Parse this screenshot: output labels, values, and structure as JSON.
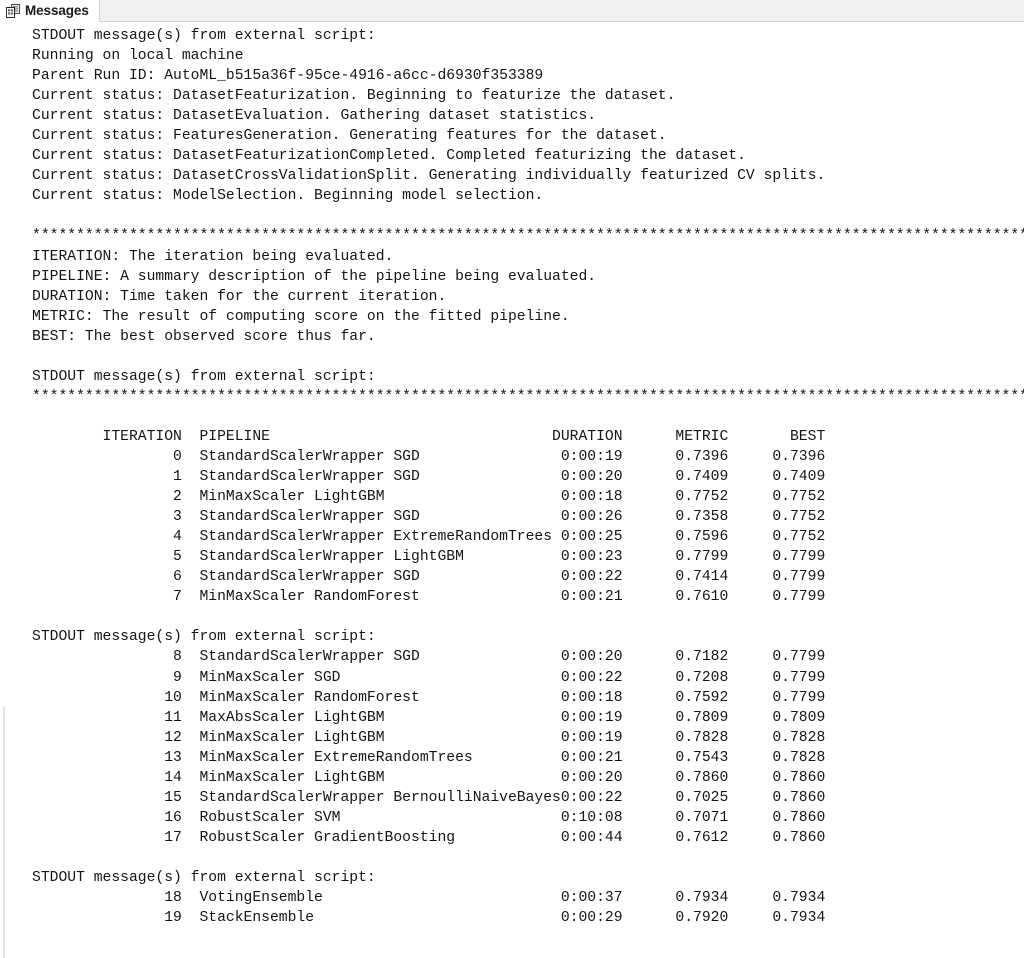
{
  "window": {
    "tab": {
      "label": "Messages",
      "icon": "messages-grid-icon"
    },
    "colors": {
      "background": "#ffffff",
      "tabstrip_background": "#f1f1f1",
      "tabstrip_border": "#d4d4d4",
      "text": "#151515",
      "rule": "#e0e0e0"
    }
  },
  "console": {
    "separator_char": "*",
    "separator_count": 119,
    "blocks": [
      {
        "type": "lines",
        "name": "run-header",
        "lines": [
          "STDOUT message(s) from external script:",
          "Running on local machine",
          "Parent Run ID: AutoML_b515a36f-95ce-4916-a6cc-d6930f353389",
          "Current status: DatasetFeaturization. Beginning to featurize the dataset.",
          "Current status: DatasetEvaluation. Gathering dataset statistics.",
          "Current status: FeaturesGeneration. Generating features for the dataset.",
          "Current status: DatasetFeaturizationCompleted. Completed featurizing the dataset.",
          "Current status: DatasetCrossValidationSplit. Generating individually featurized CV splits.",
          "Current status: ModelSelection. Beginning model selection."
        ]
      },
      {
        "type": "blank",
        "name": "blank-1"
      },
      {
        "type": "separator",
        "name": "separator-top"
      },
      {
        "type": "lines",
        "name": "legend",
        "lines": [
          "ITERATION: The iteration being evaluated.",
          "PIPELINE: A summary description of the pipeline being evaluated.",
          "DURATION: Time taken for the current iteration.",
          "METRIC: The result of computing score on the fitted pipeline.",
          "BEST: The best observed score thus far."
        ]
      },
      {
        "type": "blank",
        "name": "blank-2"
      },
      {
        "type": "lines",
        "name": "stdout-notice-2",
        "lines": [
          "STDOUT message(s) from external script:"
        ]
      },
      {
        "type": "separator",
        "name": "separator-bottom"
      },
      {
        "type": "blank",
        "name": "blank-3"
      },
      {
        "type": "table-header",
        "name": "iteration-table-header"
      },
      {
        "type": "rows",
        "name": "iteration-rows-group-1",
        "row_indices": [
          0,
          1,
          2,
          3,
          4,
          5,
          6,
          7
        ]
      },
      {
        "type": "blank",
        "name": "blank-4"
      },
      {
        "type": "lines",
        "name": "stdout-notice-3",
        "lines": [
          "STDOUT message(s) from external script:"
        ]
      },
      {
        "type": "rows",
        "name": "iteration-rows-group-2",
        "row_indices": [
          8,
          9,
          10,
          11,
          12,
          13,
          14,
          15,
          16,
          17
        ]
      },
      {
        "type": "blank",
        "name": "blank-5"
      },
      {
        "type": "lines",
        "name": "stdout-notice-4",
        "lines": [
          "STDOUT message(s) from external script:"
        ]
      },
      {
        "type": "rows",
        "name": "iteration-rows-group-3",
        "row_indices": [
          18,
          19
        ]
      }
    ]
  },
  "iteration_table": {
    "columns": [
      "ITERATION",
      "PIPELINE",
      "DURATION",
      "METRIC",
      "BEST"
    ],
    "rows": [
      {
        "iteration": "0",
        "pipeline": "StandardScalerWrapper SGD",
        "duration": "0:00:19",
        "metric": "0.7396",
        "best": "0.7396"
      },
      {
        "iteration": "1",
        "pipeline": "StandardScalerWrapper SGD",
        "duration": "0:00:20",
        "metric": "0.7409",
        "best": "0.7409"
      },
      {
        "iteration": "2",
        "pipeline": "MinMaxScaler LightGBM",
        "duration": "0:00:18",
        "metric": "0.7752",
        "best": "0.7752"
      },
      {
        "iteration": "3",
        "pipeline": "StandardScalerWrapper SGD",
        "duration": "0:00:26",
        "metric": "0.7358",
        "best": "0.7752"
      },
      {
        "iteration": "4",
        "pipeline": "StandardScalerWrapper ExtremeRandomTrees",
        "duration": "0:00:25",
        "metric": "0.7596",
        "best": "0.7752"
      },
      {
        "iteration": "5",
        "pipeline": "StandardScalerWrapper LightGBM",
        "duration": "0:00:23",
        "metric": "0.7799",
        "best": "0.7799"
      },
      {
        "iteration": "6",
        "pipeline": "StandardScalerWrapper SGD",
        "duration": "0:00:22",
        "metric": "0.7414",
        "best": "0.7799"
      },
      {
        "iteration": "7",
        "pipeline": "MinMaxScaler RandomForest",
        "duration": "0:00:21",
        "metric": "0.7610",
        "best": "0.7799"
      },
      {
        "iteration": "8",
        "pipeline": "StandardScalerWrapper SGD",
        "duration": "0:00:20",
        "metric": "0.7182",
        "best": "0.7799"
      },
      {
        "iteration": "9",
        "pipeline": "MinMaxScaler SGD",
        "duration": "0:00:22",
        "metric": "0.7208",
        "best": "0.7799"
      },
      {
        "iteration": "10",
        "pipeline": "MinMaxScaler RandomForest",
        "duration": "0:00:18",
        "metric": "0.7592",
        "best": "0.7799"
      },
      {
        "iteration": "11",
        "pipeline": "MaxAbsScaler LightGBM",
        "duration": "0:00:19",
        "metric": "0.7809",
        "best": "0.7809"
      },
      {
        "iteration": "12",
        "pipeline": "MinMaxScaler LightGBM",
        "duration": "0:00:19",
        "metric": "0.7828",
        "best": "0.7828"
      },
      {
        "iteration": "13",
        "pipeline": "MinMaxScaler ExtremeRandomTrees",
        "duration": "0:00:21",
        "metric": "0.7543",
        "best": "0.7828"
      },
      {
        "iteration": "14",
        "pipeline": "MinMaxScaler LightGBM",
        "duration": "0:00:20",
        "metric": "0.7860",
        "best": "0.7860"
      },
      {
        "iteration": "15",
        "pipeline": "StandardScalerWrapper BernoulliNaiveBayes",
        "duration": "0:00:22",
        "metric": "0.7025",
        "best": "0.7860"
      },
      {
        "iteration": "16",
        "pipeline": "RobustScaler SVM",
        "duration": "0:10:08",
        "metric": "0.7071",
        "best": "0.7860"
      },
      {
        "iteration": "17",
        "pipeline": "RobustScaler GradientBoosting",
        "duration": "0:00:44",
        "metric": "0.7612",
        "best": "0.7860"
      },
      {
        "iteration": "18",
        "pipeline": "VotingEnsemble",
        "duration": "0:00:37",
        "metric": "0.7934",
        "best": "0.7934"
      },
      {
        "iteration": "19",
        "pipeline": "StackEnsemble",
        "duration": "0:00:29",
        "metric": "0.7920",
        "best": "0.7934"
      }
    ],
    "layout": {
      "iteration_col_end": 17,
      "pipeline_col_start": 19,
      "duration_col_end": 67,
      "metric_col_end": 79,
      "best_col_end": 90
    }
  }
}
